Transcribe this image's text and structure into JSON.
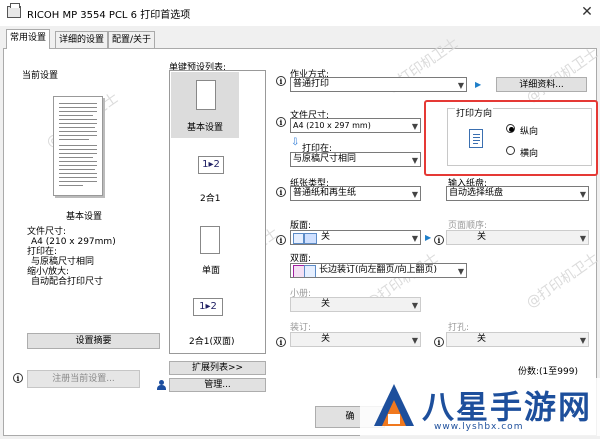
{
  "window": {
    "title": "RICOH MP 3554 PCL 6 打印首选项",
    "close_glyph": "✕"
  },
  "tabs": [
    "常用设置",
    "详细的设置",
    "配置/关于"
  ],
  "left": {
    "current_settings_label": "当前设置",
    "preset_name": "基本设置",
    "summary_lines": [
      "文件尺寸:",
      "A4 (210 x 297mm)",
      "打印在:",
      "与原稿尺寸相同",
      "缩小/放大:",
      "自动配合打印尺寸"
    ],
    "summary_button": "设置摘要",
    "register_button": "注册当前设置...",
    "info_glyph": "i"
  },
  "presets": {
    "label": "单键预设列表:",
    "items": [
      "基本设置",
      "2合1",
      "单面",
      "2合1(双面)"
    ],
    "twoup_glyph": "1▸2",
    "expand_button": "扩展列表>>",
    "manage_button": "管理..."
  },
  "job": {
    "label": "作业方式:",
    "value": "普通打印",
    "detail_button": "详细资料..."
  },
  "paper_size": {
    "label": "文件尺寸:",
    "value": "A4 (210 x 297 mm)"
  },
  "print_on": {
    "label": "打印在:",
    "value": "与原稿尺寸相同"
  },
  "orientation": {
    "label": "打印方向",
    "options": [
      "纵向",
      "横向"
    ],
    "selected": "纵向"
  },
  "paper_type": {
    "label": "纸张类型:",
    "value": "普通纸和再生纸"
  },
  "input_tray": {
    "label": "输入纸盘:",
    "value": "自动选择纸盘"
  },
  "cover": {
    "label": "版面:",
    "value": "关"
  },
  "page_order": {
    "label": "页面顺序:",
    "value": "关"
  },
  "duplex": {
    "label": "双面:",
    "value": "长边装订(向左翻页/向上翻页)"
  },
  "booklet": {
    "label": "小册:",
    "value": "关"
  },
  "staple": {
    "label": "装订:",
    "value": "关"
  },
  "punch": {
    "label": "打孔:",
    "value": "关"
  },
  "copies": {
    "label": "份数:(1至999)"
  },
  "ok_button": "确",
  "watermark": "@打印机卫士",
  "logo": {
    "text": "八星手游网",
    "url": "www.lyshbx.com"
  },
  "colors": {
    "highlight": "#e53935",
    "logo_orange": "#f0781e",
    "logo_blue": "#1d4f9c"
  }
}
